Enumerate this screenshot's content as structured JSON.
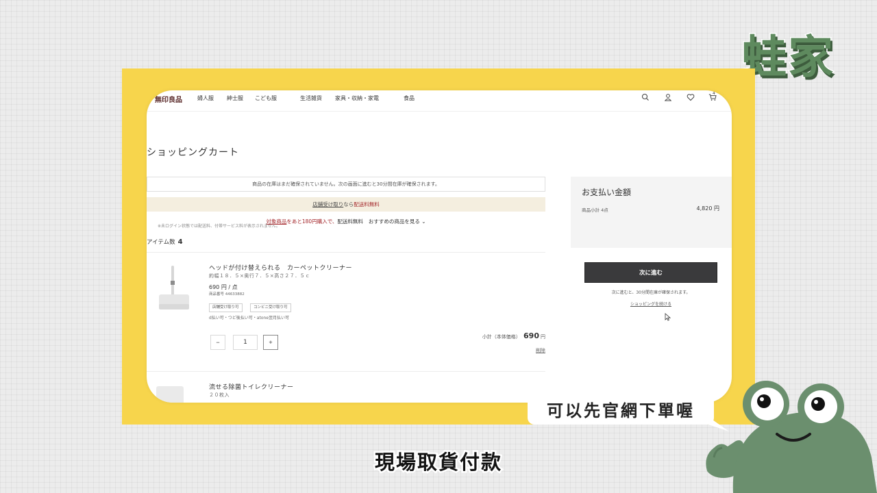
{
  "brand": {
    "text": "蛙家"
  },
  "nav": {
    "logo": "無印良品",
    "items": [
      "婦人服",
      "紳士服",
      "こども服",
      "生活雑貨",
      "家具・収納・家電",
      "食品"
    ],
    "cart_count": "4",
    "icons": [
      "search-icon",
      "user-icon",
      "heart-icon",
      "cart-icon"
    ]
  },
  "cart": {
    "title": "ショッピングカート",
    "notice": "商品の在庫はまだ確保されていません。次の画面に進むと30分間在庫が確保されます。",
    "store_pickup_link": "店舗受け取り",
    "store_pickup_mid": "なら",
    "store_pickup_free": "配送料無料",
    "promo_target": "対象商品",
    "promo_text": "をあと180円購入で、",
    "promo_free": "配送料無料",
    "promo_recommend": "おすすめの商品を見る",
    "item_count_label": "アイテム数",
    "item_count": "4"
  },
  "product1": {
    "name": "ヘッドが付け替えられる　カーペットクリーナー",
    "size": "約幅１８．５×奥行７．５×高さ２７．５ｃ",
    "price": "690 円 / 点",
    "code": "商品番号 44633882",
    "tags": [
      "店舗受け取り可",
      "コンビニ受け取り可"
    ],
    "payment_note": "d払い可・つど後払い可・atone翌月払い可",
    "qty": "1",
    "minus": "−",
    "plus": "+",
    "subtotal_label": "小計（本体価格）",
    "subtotal_value": "690",
    "subtotal_unit": "円",
    "delete_label": "削除"
  },
  "product2": {
    "name": "流せる除菌トイレクリーナー",
    "size": "２０枚入"
  },
  "summary": {
    "title": "お支払い金額",
    "subtotal_label": "商品小計 4点",
    "subtotal_value": "4,820 円",
    "note": "※未ログイン状態では配送料、付帯サービス料が表示されません。",
    "next_button": "次に進む",
    "next_note": "次に進むと、30分間在庫が確保されます。",
    "continue_link": "ショッピングを続ける"
  },
  "overlay": {
    "bubble": "可以先官網下單喔",
    "subtitle": "現場取貨付款"
  },
  "colors": {
    "frame_yellow": "#f7d54c",
    "brand_green": "#5e8a5e",
    "promo_red": "#a3262a",
    "button_dark": "#3a3a3c"
  }
}
